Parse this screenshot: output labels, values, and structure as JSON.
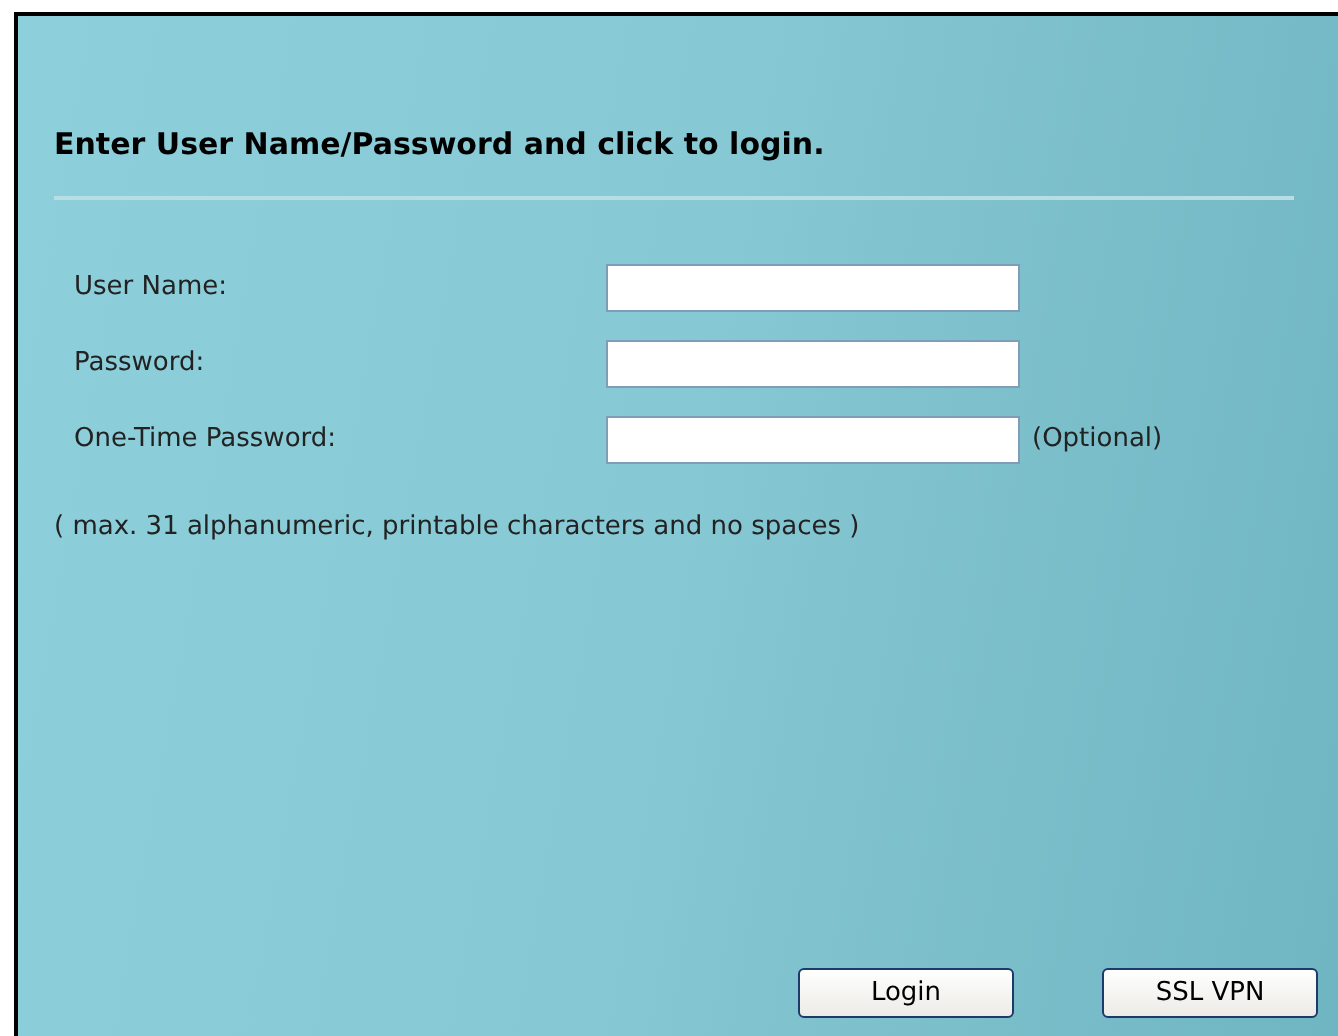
{
  "heading": "Enter User Name/Password and click to login.",
  "fields": [
    {
      "label": "User Name:"
    },
    {
      "label": "Password:"
    },
    {
      "label": "One-Time Password:",
      "note": "(Optional)"
    }
  ],
  "hint": "( max. 31 alphanumeric, printable characters and no spaces )",
  "buttons": [
    "Login",
    "SSL VPN"
  ]
}
